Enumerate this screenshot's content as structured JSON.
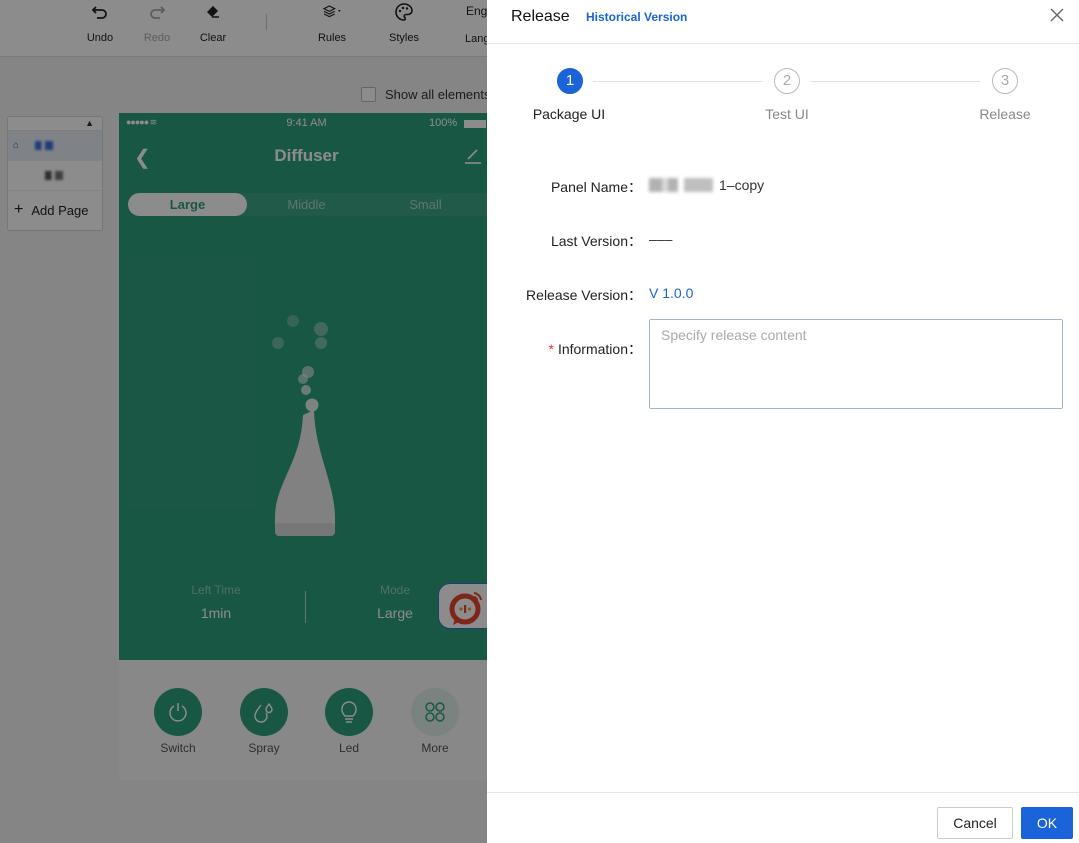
{
  "toolbar": {
    "items": [
      {
        "label": "Undo",
        "icon": "undo-icon",
        "enabled": true
      },
      {
        "label": "Redo",
        "icon": "redo-icon",
        "enabled": false
      },
      {
        "label": "Clear",
        "icon": "eraser-icon",
        "enabled": true
      },
      {
        "label": "Rules",
        "icon": "layers-icon",
        "enabled": true
      },
      {
        "label": "Styles",
        "icon": "palette-icon",
        "enabled": true
      }
    ],
    "language_value": "Eng",
    "language_label": "Lang"
  },
  "canvas": {
    "show_all_elements_label": "Show all elements",
    "show_all_elements_checked": false
  },
  "pages_panel": {
    "add_page_label": "Add Page"
  },
  "phone": {
    "status_time": "9:41 AM",
    "status_battery": "100%",
    "title": "Diffuser",
    "segments": [
      "Large",
      "Middle",
      "Small"
    ],
    "active_segment": "Large",
    "stats": [
      {
        "label": "Left Time",
        "value": "1min"
      },
      {
        "label": "Mode",
        "value": "Large"
      }
    ],
    "functions": [
      {
        "label": "Switch",
        "icon": "power-icon"
      },
      {
        "label": "Spray",
        "icon": "droplets-icon"
      },
      {
        "label": "Led",
        "icon": "bulb-icon"
      },
      {
        "label": "More",
        "icon": "grid-icon"
      }
    ],
    "colors": {
      "primary": "#2f9e7e"
    }
  },
  "drawer": {
    "title": "Release",
    "historical_link": "Historical Version",
    "steps": [
      {
        "number": "1",
        "label": "Package UI",
        "status": "active"
      },
      {
        "number": "2",
        "label": "Test UI",
        "status": "todo"
      },
      {
        "number": "3",
        "label": "Release",
        "status": "todo"
      }
    ],
    "form": {
      "panel_name_label": "Panel Name：",
      "panel_name_value": "1–copy",
      "last_version_label": "Last Version：",
      "last_version_value": "–––",
      "release_version_label": "Release Version：",
      "release_version_value": "V 1.0.0",
      "information_required_mark": "*",
      "information_label": "Information：",
      "information_placeholder": "Specify release content",
      "information_value": ""
    },
    "footer": {
      "cancel_label": "Cancel",
      "ok_label": "OK"
    },
    "colors": {
      "accent": "#1a63d8",
      "required": "#e2312c"
    }
  }
}
